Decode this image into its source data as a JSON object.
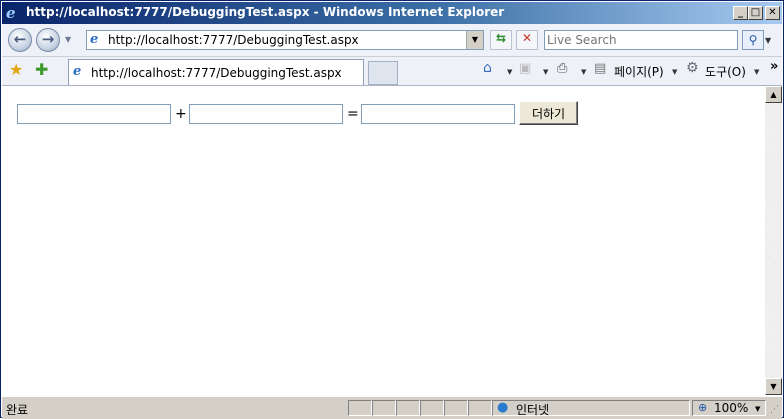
{
  "window": {
    "title": "http://localhost:7777/DebuggingTest.aspx - Windows Internet Explorer",
    "buttons": {
      "minimize": "_",
      "maximize": "□",
      "close": "✕"
    }
  },
  "address_bar": {
    "url": "http://localhost:7777/DebuggingTest.aspx"
  },
  "search": {
    "placeholder": "Live Search"
  },
  "tab": {
    "label": "http://localhost:7777/DebuggingTest.aspx"
  },
  "command_bar": {
    "page_label": "페이지(P)",
    "tools_label": "도구(O)"
  },
  "form": {
    "input1_value": "",
    "plus": "+",
    "input2_value": "",
    "equals": "=",
    "result_value": "",
    "button_label": "더하기"
  },
  "status": {
    "text": "완료",
    "zone": "인터넷",
    "zoom": "100%"
  },
  "icons": [
    "ie-logo-icon",
    "back-icon",
    "forward-icon",
    "page-icon",
    "refresh-icon",
    "stop-icon",
    "search-icon",
    "favorites-star-icon",
    "add-favorites-icon",
    "home-icon",
    "feeds-icon",
    "print-icon",
    "page-menu-icon",
    "tools-gear-icon",
    "globe-icon",
    "zoom-icon"
  ]
}
